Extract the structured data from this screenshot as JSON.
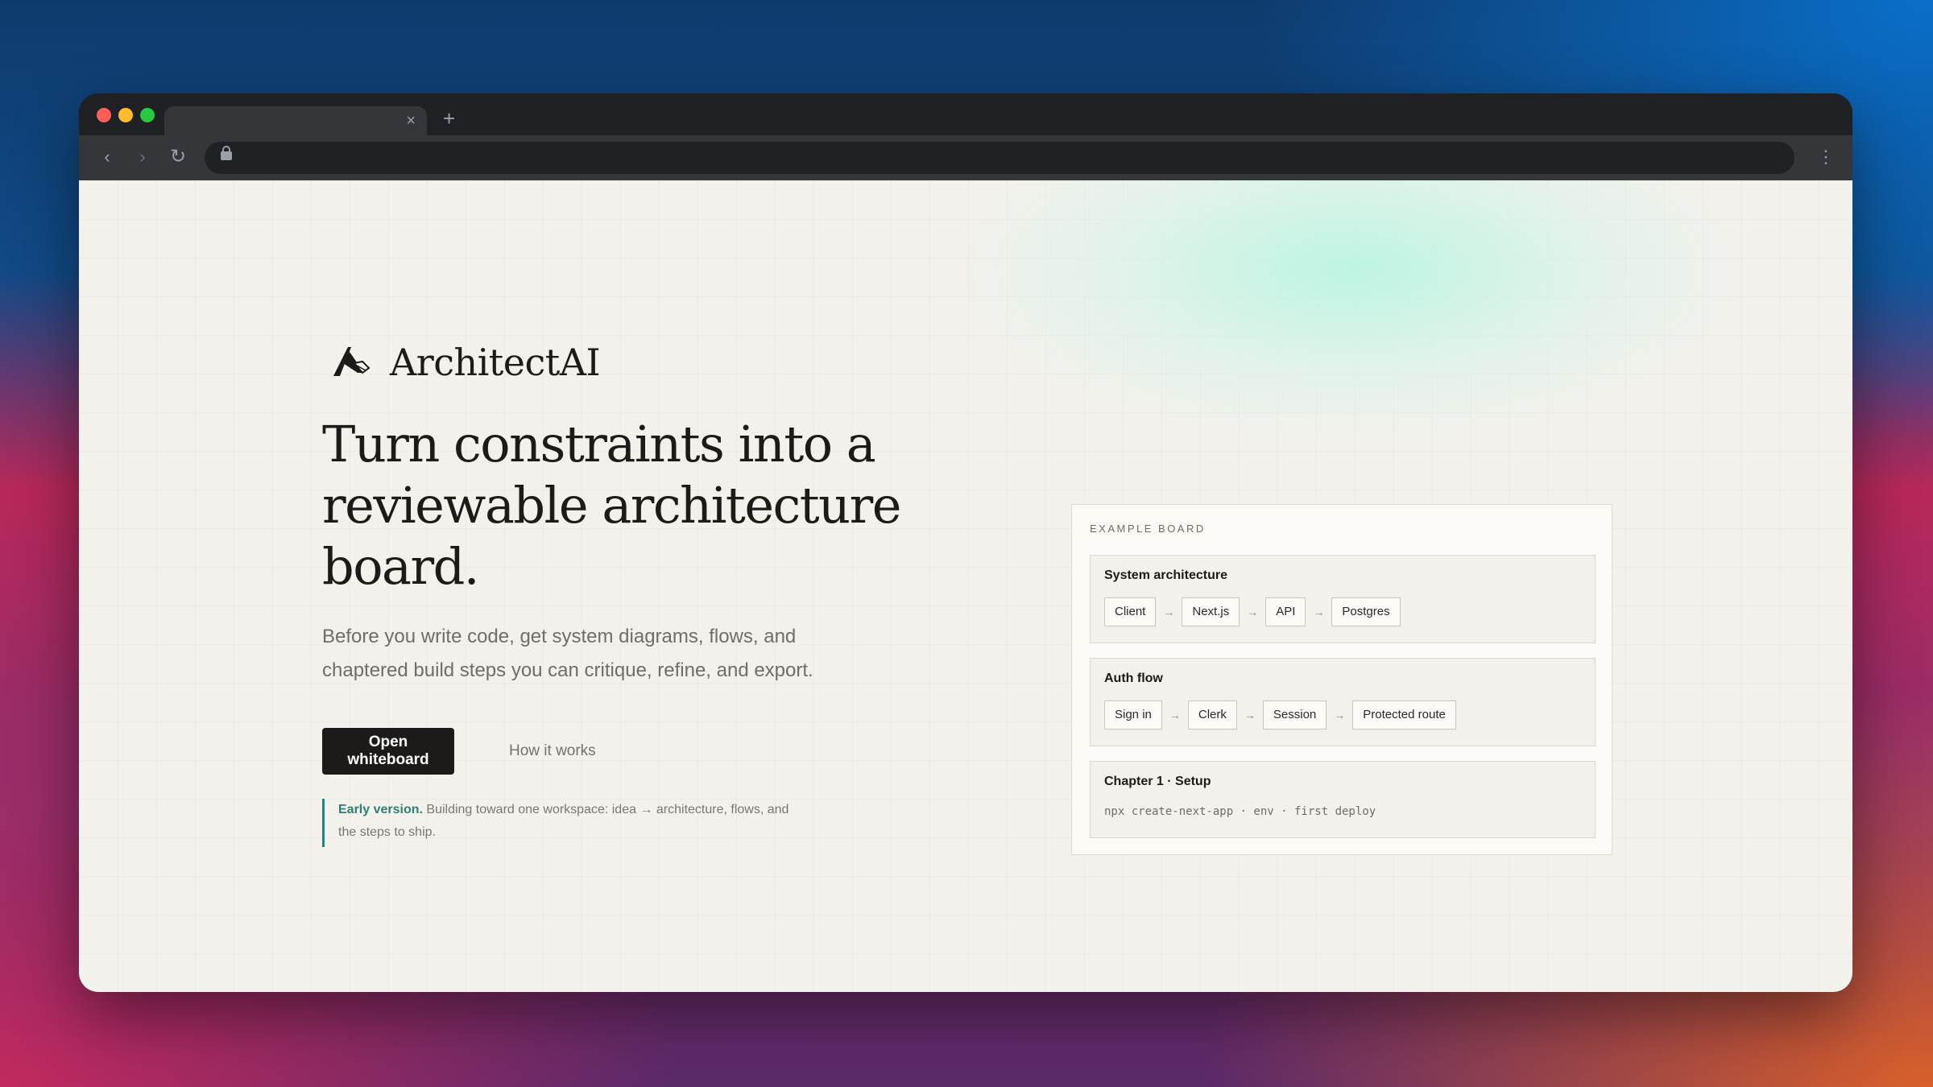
{
  "browser": {
    "tab_title": "",
    "tab_close": "×",
    "new_tab": "+",
    "url": ""
  },
  "brand": {
    "name": "ArchitectAI"
  },
  "hero": {
    "headline": "Turn constraints into a reviewable architecture board.",
    "subtitle": "Before you write code, get system diagrams, flows, and chaptered build steps you can critique, refine, and export.",
    "primary_cta": "Open whiteboard",
    "secondary_cta": "How it works",
    "note_emphasis": "Early version.",
    "note_text": " Building toward one workspace: idea → architecture, flows, and the steps to ship."
  },
  "board": {
    "label": "EXAMPLE BOARD",
    "arrow": "→",
    "system": {
      "title": "System architecture",
      "nodes": [
        "Client",
        "Next.js",
        "API",
        "Postgres"
      ]
    },
    "auth": {
      "title": "Auth flow",
      "nodes": [
        "Sign in",
        "Clerk",
        "Session",
        "Protected route"
      ]
    },
    "chapter": {
      "title": "Chapter 1 · Setup",
      "code": "npx create-next-app · env · first deploy"
    }
  },
  "colors": {
    "accent": "#2e7f74",
    "ink": "#1c1b1a",
    "page_bg": "#f2f1ec"
  }
}
